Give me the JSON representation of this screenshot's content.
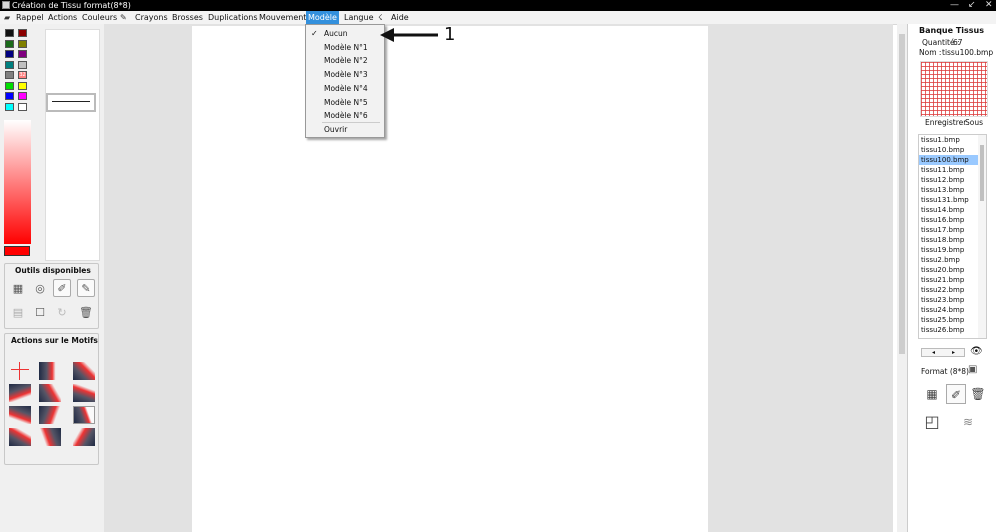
{
  "window": {
    "title": "Création de Tissu format(8*8)",
    "controls": [
      "—",
      "↙",
      "✕"
    ]
  },
  "menu": {
    "items": [
      "Rappel",
      "Actions",
      "Couleurs",
      "Crayons",
      "Brosses",
      "Duplications",
      "Mouvement",
      "Modèle",
      "Langue",
      "Aide"
    ]
  },
  "dropdown": {
    "items": [
      "Aucun",
      "Modèle N°1",
      "Modèle N°2",
      "Modèle N°3",
      "Modèle N°4",
      "Modèle N°5",
      "Modèle N°6",
      "Ouvrir"
    ],
    "checked": "Aucun"
  },
  "annotation": {
    "number": "1"
  },
  "left": {
    "palette": [
      "#111111",
      "#8b0000",
      "#1a6a1a",
      "#808000",
      "#000080",
      "#800080",
      "#008080",
      "#c0c0c0",
      "#808080",
      "#ff8080",
      "#00dd00",
      "#ffff00",
      "#0000ff",
      "#ff00ff",
      "#00ffff",
      "#ffffff"
    ],
    "special_sw": "32",
    "current_color": "#ff0000",
    "tools_title": "Outils  disponibles",
    "motifs_title": "Actions sur le Motifs"
  },
  "right": {
    "title": "Banque Tissus",
    "quantity_label": "Quantité :",
    "quantity_value": "67",
    "name_label": "Nom :",
    "name_value": "tissu100.bmp",
    "save_label": "Enregistrer",
    "save_as_label": "Sous",
    "files": [
      "tissu1.bmp",
      "tissu10.bmp",
      "tissu100.bmp",
      "tissu11.bmp",
      "tissu12.bmp",
      "tissu13.bmp",
      "tissu131.bmp",
      "tissu14.bmp",
      "tissu16.bmp",
      "tissu17.bmp",
      "tissu18.bmp",
      "tissu19.bmp",
      "tissu2.bmp",
      "tissu20.bmp",
      "tissu21.bmp",
      "tissu22.bmp",
      "tissu23.bmp",
      "tissu24.bmp",
      "tissu25.bmp",
      "tissu26.bmp"
    ],
    "selected_file": "tissu100.bmp",
    "format_label": "Format (8*8)"
  }
}
